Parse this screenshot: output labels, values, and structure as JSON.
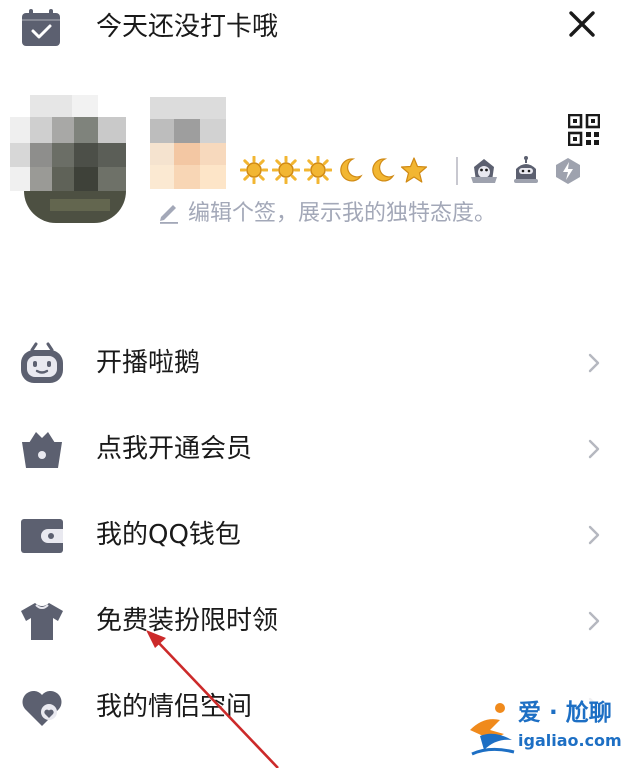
{
  "header": {
    "checkin_text": "今天还没打卡哦",
    "checkin_icon": "calendar-check-icon",
    "close_icon": "close-icon"
  },
  "profile": {
    "signature_placeholder": "编辑个签，展示我的独特态度。",
    "qr_icon": "qr-code-icon",
    "level_icons": [
      "sun",
      "sun",
      "sun",
      "moon",
      "moon",
      "star"
    ],
    "badge_icons": [
      "penguin-badge",
      "robot-badge",
      "lightning-badge"
    ]
  },
  "menu": [
    {
      "label": "开播啦鹅",
      "icon": "tv-robot-icon"
    },
    {
      "label": "点我开通会员",
      "icon": "vip-basket-icon"
    },
    {
      "label": "我的QQ钱包",
      "icon": "wallet-icon"
    },
    {
      "label": "免费装扮限时领",
      "icon": "shirt-icon"
    },
    {
      "label": "我的情侣空间",
      "icon": "heart-icon"
    }
  ],
  "watermark": {
    "brand": "爱 · 尬聊",
    "url": "igaliao.com"
  },
  "colors": {
    "icon_gray": "#5c6070",
    "icon_light": "#e9e9f0",
    "placeholder": "#a3a8b8",
    "chevron": "#b5b8c0",
    "arrow": "#cc2a2a",
    "gold": "#f2b632",
    "watermark_blue": "#1d6fc4",
    "watermark_orange": "#f08a1c"
  }
}
